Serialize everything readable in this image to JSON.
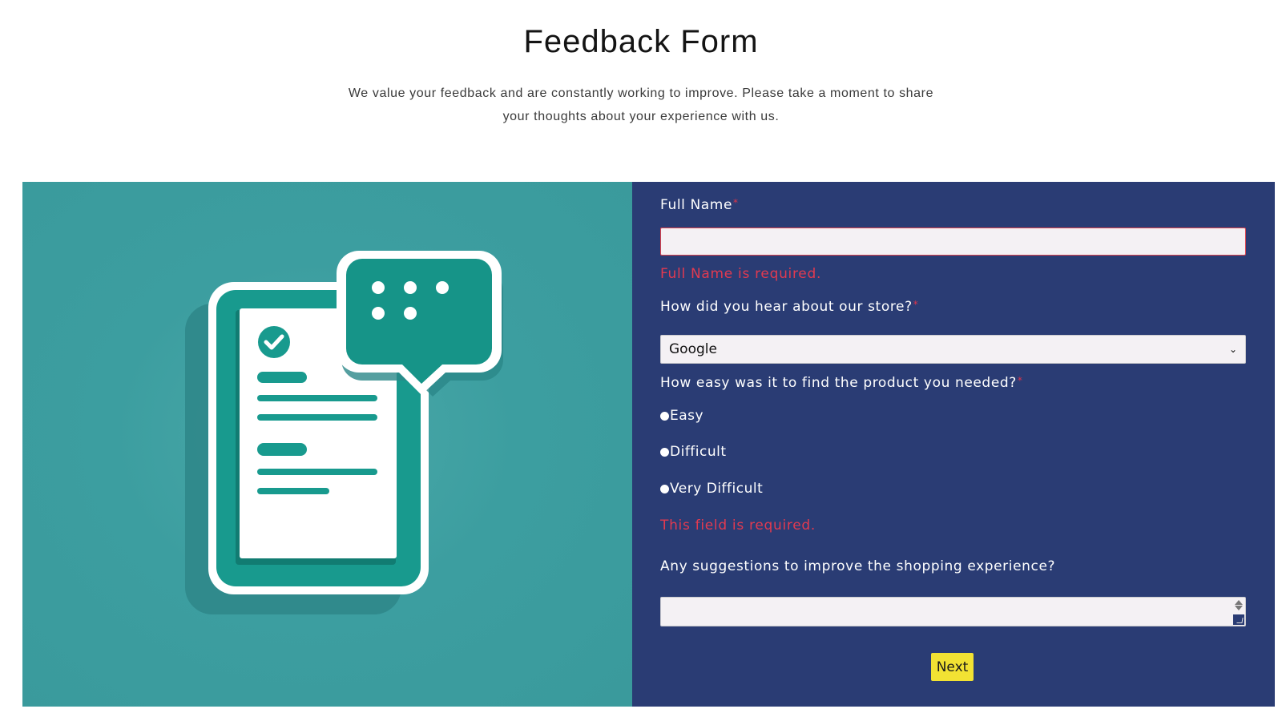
{
  "header": {
    "title": "Feedback Form",
    "intro_line1": "We value your feedback and are constantly working to improve. Please take a moment to share",
    "intro_line2": "your thoughts about your experience with us."
  },
  "colors": {
    "illustration_bg": "#3a9a9c",
    "form_bg": "#2a3c74",
    "error": "#e23a50",
    "next_button_bg": "#f2e233",
    "input_bg": "#f4f1f4"
  },
  "illustration": {
    "icon": "feedback-document-chat-icon"
  },
  "form": {
    "full_name": {
      "label": "Full Name",
      "required_mark": "*",
      "value": "",
      "error": "Full Name is required."
    },
    "source": {
      "label": "How did you hear about our store?",
      "required_mark": "*",
      "selected": "Google",
      "chevron_icon": "chevron-down-icon"
    },
    "ease": {
      "label": "How easy was it to find the product you needed?",
      "required_mark": "*",
      "options": [
        "Easy",
        "Difficult",
        "Very Difficult"
      ],
      "error": "This field is required."
    },
    "suggestions": {
      "label": "Any suggestions to improve the shopping experience?",
      "value": ""
    },
    "next_label": "Next"
  }
}
